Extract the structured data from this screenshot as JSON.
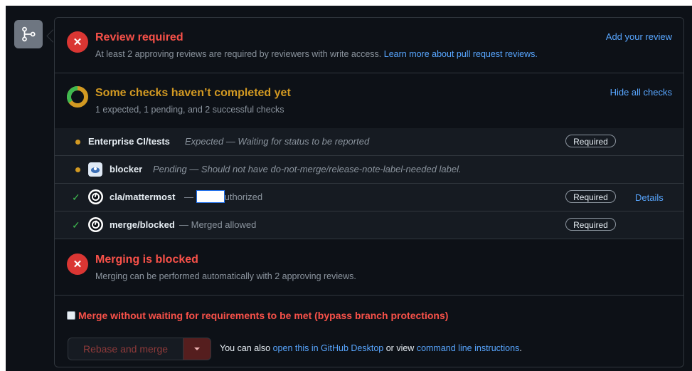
{
  "review": {
    "title": "Review required",
    "message": "At least 2 approving reviews are required by reviewers with write access.",
    "learn_more": "Learn more about pull request reviews.",
    "action": "Add your review"
  },
  "checks": {
    "title": "Some checks haven’t completed yet",
    "summary": "1 expected, 1 pending, and 2 successful checks",
    "action": "Hide all checks",
    "items": [
      {
        "name": "Enterprise CI/tests",
        "status": "Expected — Waiting for status to be reported",
        "badge": "Required",
        "state": "pending"
      },
      {
        "name": "blocker",
        "status": "Pending — Should not have do-not-merge/release-note-label-needed label.",
        "state": "pending"
      },
      {
        "name": "cla/mattermost",
        "dash": " — ",
        "status": "uthorized",
        "badge": "Required",
        "details": "Details",
        "state": "success"
      },
      {
        "name": "merge/blocked",
        "status": " — Merged allowed",
        "badge": "Required",
        "state": "success"
      }
    ]
  },
  "merge_status": {
    "title": "Merging is blocked",
    "message": "Merging can be performed automatically with 2 approving reviews."
  },
  "bypass": {
    "label": "Merge without waiting for requirements to be met (bypass branch protections)"
  },
  "merge_actions": {
    "button": "Rebase and merge",
    "you_can_also": "You can also",
    "desktop_link": "open this in GitHub Desktop",
    "or_view": "or view",
    "cli_link": "command line instructions",
    "period": "."
  },
  "colors": {
    "danger": "#f85149",
    "warning": "#d29922",
    "success": "#3fb950",
    "link": "#58a6ff"
  }
}
